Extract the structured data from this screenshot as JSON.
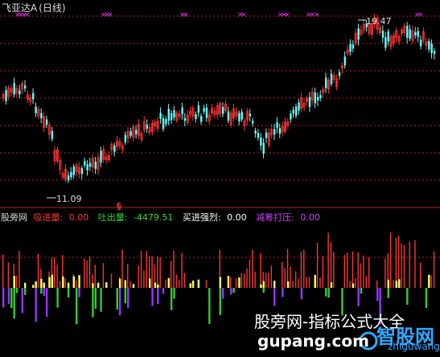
{
  "header": {
    "stock_name": "飞亚达A",
    "period": "(日线)"
  },
  "chart_annotations": {
    "high_label": "19.47",
    "low_label": "11.09",
    "signal_mark": "§"
  },
  "indicator": {
    "name": "股旁网",
    "items": [
      {
        "label": "吸进量:",
        "value": "0.00",
        "color": "#ff3333"
      },
      {
        "label": "吐出量:",
        "value": "-4479.51",
        "color": "#33dd33"
      },
      {
        "label": "买进强烈:",
        "value": "0.00",
        "color": "#ffffff"
      },
      {
        "label": "减筹打压:",
        "value": "0.00",
        "color": "#cc44ff"
      }
    ]
  },
  "watermark": {
    "text": "股旁网-指标公式大全",
    "url": "gupang.com",
    "logo_text": "智股网",
    "logo_url": "zhiguwang"
  },
  "colors": {
    "up": "#ff3333",
    "down": "#66ffff",
    "grid": "#b22222",
    "magenta": "#ff33ff",
    "yellow": "#ffff66",
    "green": "#33cc33",
    "purple": "#9933ff"
  }
}
